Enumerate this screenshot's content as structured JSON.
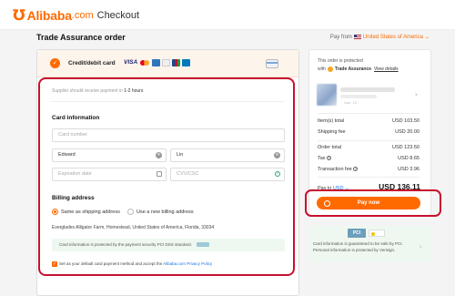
{
  "header": {
    "brand": "Alibaba",
    "brand_suffix": ".com",
    "section": "Checkout"
  },
  "page": {
    "title": "Trade Assurance order",
    "pay_from_label": "Pay from",
    "pay_from_country": "United States of America"
  },
  "payment": {
    "method_label": "Credit/debit card",
    "brands": [
      "VISA",
      "Mastercard",
      "Amex",
      "Discover",
      "JCB",
      "Diners"
    ],
    "notice_prefix": "Supplier should receive payment in",
    "notice_value": "1-2 hours",
    "card_info_title": "Card information",
    "card_number_placeholder": "Card number",
    "first_name": "Edward",
    "last_name": "Lin",
    "expiry_placeholder": "Expiration date",
    "cvv_placeholder": "CVV/CSC",
    "billing_title": "Billing address",
    "option_same": "Same as shipping address",
    "option_new": "Use a new billing address",
    "address": "Everglades Alligator Farm, Homestead, United States of America, Florida, 33034",
    "pci_note": "Card information is protected by the payment security PCI DSS standard.",
    "default_label": "Set as your default card payment method and accept the",
    "policy_link": "Alibaba.com Privacy Policy"
  },
  "summary": {
    "protect_line": "This order is protected",
    "with_label": "with",
    "ta_label": "Trade Assurance",
    "view_details": "View details",
    "product_sub": "Uan: 10",
    "rows": [
      {
        "label": "Item(s) total",
        "value": "USD 103.50"
      },
      {
        "label": "Shipping fee",
        "value": "USD 20.00"
      },
      {
        "label": "Order total",
        "value": "USD 123.50"
      },
      {
        "label": "Tax",
        "value": "USD 8.65"
      },
      {
        "label": "Transaction fee",
        "value": "USD 3.96"
      }
    ],
    "pay_in_label": "Pay in",
    "pay_in_currency": "USD",
    "total": "USD 136.11",
    "pay_button": "Pay now"
  },
  "security": {
    "pci_logo": "PCI",
    "text": "Card information is guaranteed to be safe by PCI. Personal information is protected by Verisign."
  },
  "colors": {
    "accent": "#ff6a00",
    "highlight_frame": "#c8102e",
    "link": "#1a73e8"
  }
}
